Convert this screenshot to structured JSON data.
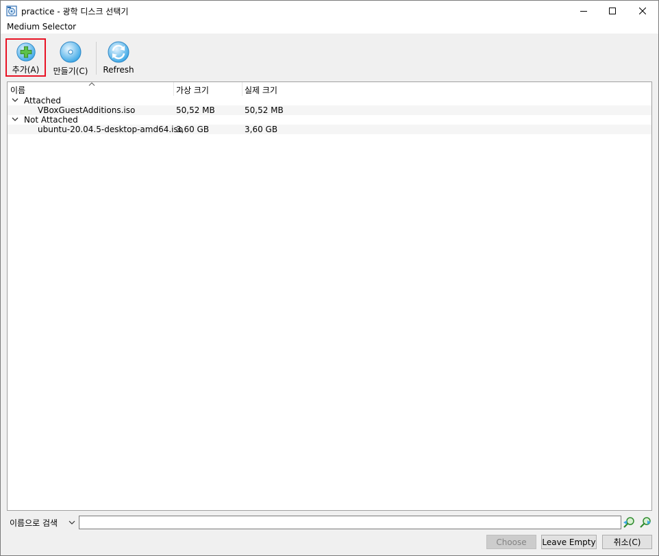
{
  "window": {
    "title": "practice - 광학 디스크 선택기"
  },
  "header": {
    "label": "Medium Selector"
  },
  "toolbar": {
    "add_label": "추가(A)",
    "create_label": "만들기(C)",
    "refresh_label": "Refresh"
  },
  "tree": {
    "columns": [
      "이름",
      "가상 크기",
      "실제 크기"
    ],
    "groups": [
      {
        "label": "Attached",
        "items": [
          {
            "name": "VBoxGuestAdditions.iso",
            "virtual_size": "50,52 MB",
            "actual_size": "50,52 MB"
          }
        ]
      },
      {
        "label": "Not Attached",
        "items": [
          {
            "name": "ubuntu-20.04.5-desktop-amd64.iso",
            "virtual_size": "3,60 GB",
            "actual_size": "3,60 GB"
          }
        ]
      }
    ]
  },
  "search": {
    "mode": "이름으로 검색",
    "value": ""
  },
  "buttons": {
    "choose": "Choose",
    "leave_empty": "Leave Empty",
    "cancel": "취소(C)"
  },
  "colors": {
    "highlight_border": "#e81123",
    "icon_accent": "#3fa9e6",
    "add_plus": "#5cc24a"
  }
}
